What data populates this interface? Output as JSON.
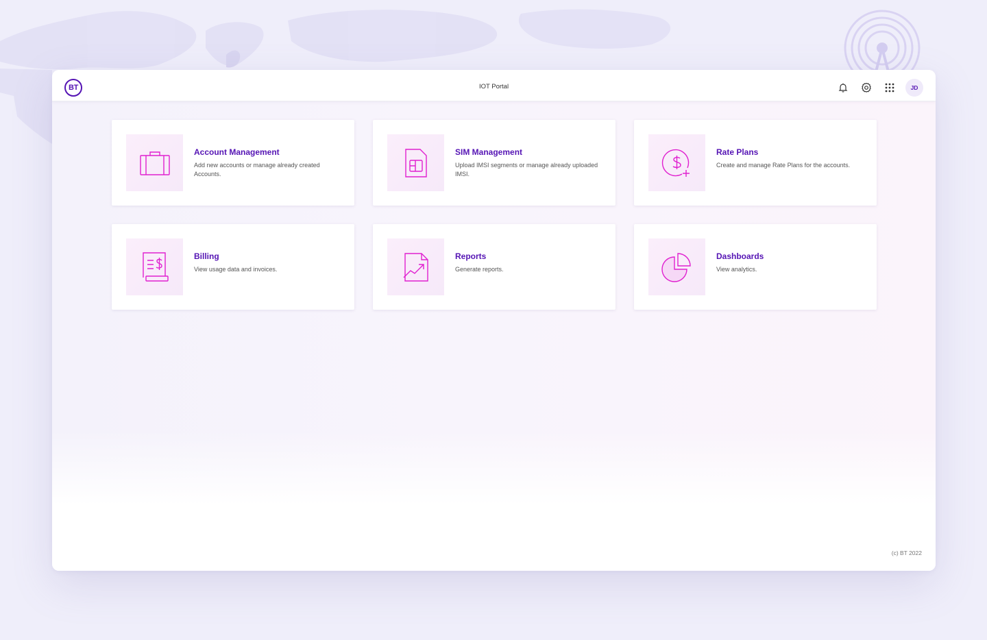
{
  "header": {
    "logo_text": "BT",
    "title": "IOT Portal",
    "icons": [
      "bell-icon",
      "gear-icon",
      "apps-grid-icon"
    ],
    "avatar_initials": "JD"
  },
  "cards": [
    {
      "title": "Account Management",
      "description": "Add new accounts or manage already created Accounts.",
      "icon": "briefcase-icon"
    },
    {
      "title": "SIM Management",
      "description": "Upload IMSI segments or manage already uploaded IMSI.",
      "icon": "sim-card-icon"
    },
    {
      "title": "Rate Plans",
      "description": "Create and manage Rate Plans for the  accounts.",
      "icon": "dollar-plus-icon"
    },
    {
      "title": "Billing",
      "description": "View usage data and invoices.",
      "icon": "invoice-icon"
    },
    {
      "title": "Reports",
      "description": "Generate reports.",
      "icon": "report-trend-icon"
    },
    {
      "title": "Dashboards",
      "description": "View analytics.",
      "icon": "pie-chart-icon"
    }
  ],
  "footer": {
    "copyright": "(c) BT 2022"
  },
  "colors": {
    "brand": "#5514b4",
    "icon_accent": "#e020d0",
    "background": "#efeefa"
  }
}
